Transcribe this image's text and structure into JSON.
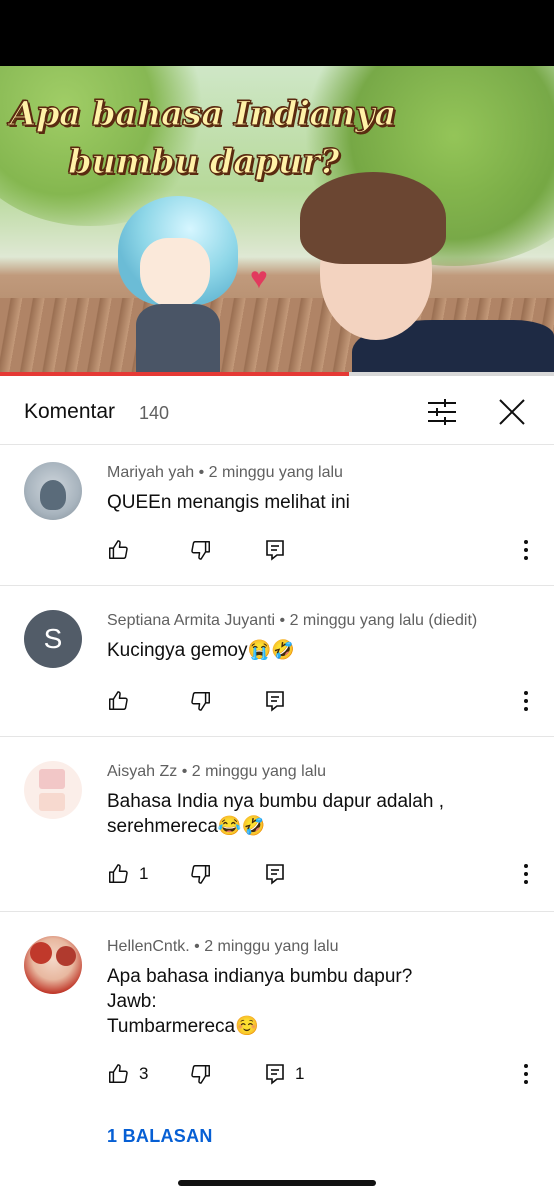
{
  "video": {
    "title_line1": "Apa bahasa Indianya",
    "title_line2": "bumbu dapur?",
    "progress": 0.63
  },
  "header": {
    "title": "Komentar",
    "count": "140"
  },
  "comments": [
    {
      "author_meta": "Mariyah yah • 2 minggu yang lalu",
      "text": "QUEEn menangis melihat ini",
      "likes": "",
      "replies_count": ""
    },
    {
      "avatar_letter": "S",
      "author_meta": "Septiana Armita Juyanti • 2 minggu yang lalu (diedit)",
      "text": "Kucingya gemoy😭🤣",
      "likes": "",
      "replies_count": ""
    },
    {
      "author_meta": "Aisyah Zz • 2 minggu yang lalu",
      "text": "Bahasa India nya bumbu dapur adalah ,\nserehmereca😂🤣",
      "likes": "1",
      "replies_count": ""
    },
    {
      "author_meta": "HellenCntk. • 2 minggu yang lalu",
      "text": "Apa bahasa indianya bumbu dapur?\nJawb:\nTumbarmereca☺️",
      "likes": "3",
      "replies_count": "1",
      "replies_link": "1 BALASAN"
    }
  ],
  "colors": {
    "accent_link": "#065fd4",
    "progress": "#e53935",
    "avatar_letter_bg": "#525c68"
  }
}
